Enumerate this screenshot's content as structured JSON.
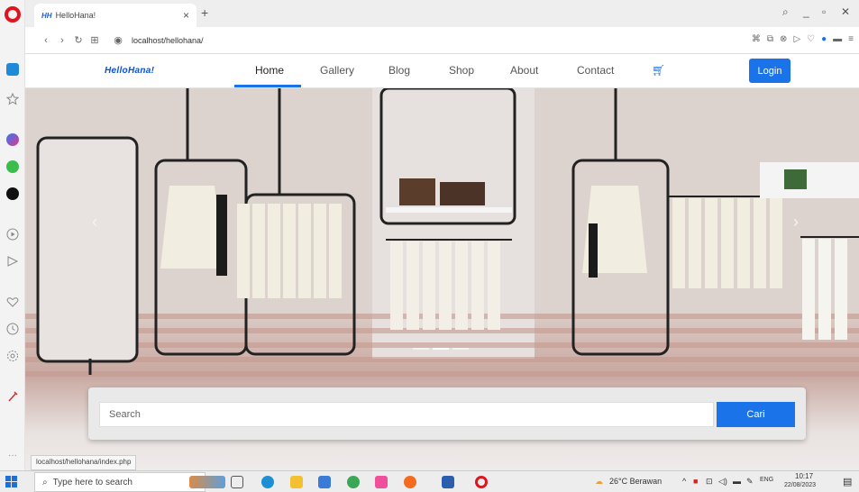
{
  "browser": {
    "tab_title": "HelloHana!",
    "tab_favicon": "HH",
    "url": "localhost/hellohana/",
    "status_url": "localhost/hellohana/index.php"
  },
  "site": {
    "brand": "HelloHana!",
    "nav": [
      "Home",
      "Gallery",
      "Blog",
      "Shop",
      "About",
      "Contact"
    ],
    "login": "Login",
    "search": {
      "placeholder": "Search",
      "button": "Cari"
    }
  },
  "taskbar": {
    "search_placeholder": "Type here to search",
    "weather": "26°C Berawan",
    "lang": "ENG",
    "time": "10:17",
    "date": "22/08/2023"
  },
  "colors": {
    "accent": "#1a73e8",
    "opera_red": "#e0141e"
  }
}
